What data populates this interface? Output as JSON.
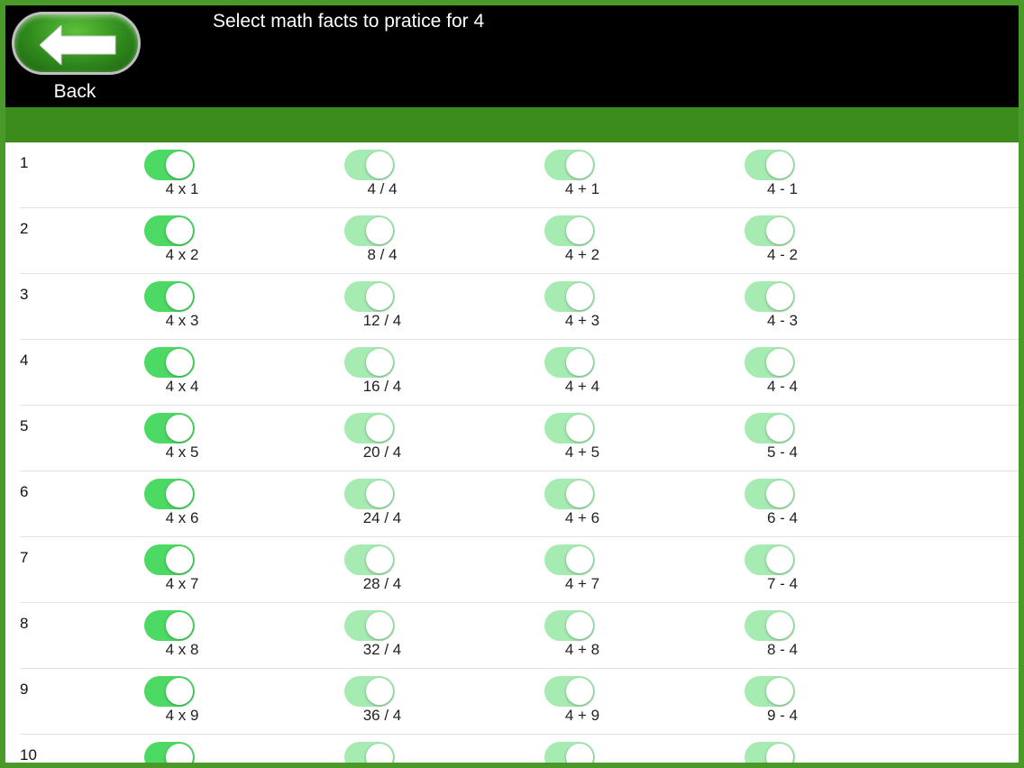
{
  "header": {
    "title": "Select math facts to pratice for 4",
    "back_label": "Back"
  },
  "colors": {
    "frame_green": "#4a9a2a",
    "band_green": "#3b8c1c",
    "toggle_on": "#4cd964",
    "toggle_dim": "#a6ebb2"
  },
  "rows": [
    {
      "num": "1",
      "facts": [
        "4 x 1",
        "4 / 4",
        "4 + 1",
        "4 - 1"
      ]
    },
    {
      "num": "2",
      "facts": [
        "4 x 2",
        "8 / 4",
        "4 + 2",
        "4 - 2"
      ]
    },
    {
      "num": "3",
      "facts": [
        "4 x 3",
        "12 / 4",
        "4 + 3",
        "4 - 3"
      ]
    },
    {
      "num": "4",
      "facts": [
        "4 x 4",
        "16 / 4",
        "4 + 4",
        "4 - 4"
      ]
    },
    {
      "num": "5",
      "facts": [
        "4 x 5",
        "20 / 4",
        "4 + 5",
        "5 - 4"
      ]
    },
    {
      "num": "6",
      "facts": [
        "4 x 6",
        "24 / 4",
        "4 + 6",
        "6 - 4"
      ]
    },
    {
      "num": "7",
      "facts": [
        "4 x 7",
        "28 / 4",
        "4 + 7",
        "7 - 4"
      ]
    },
    {
      "num": "8",
      "facts": [
        "4 x 8",
        "32 / 4",
        "4 + 8",
        "8 - 4"
      ]
    },
    {
      "num": "9",
      "facts": [
        "4 x 9",
        "36 / 4",
        "4 + 9",
        "9 - 4"
      ]
    },
    {
      "num": "10",
      "facts": [
        "",
        "",
        "",
        ""
      ]
    }
  ]
}
